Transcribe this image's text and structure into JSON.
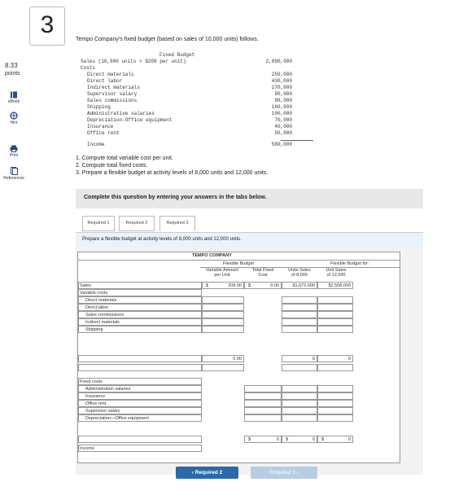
{
  "question": {
    "number": "3",
    "points_value": "8.33",
    "points_label": "points"
  },
  "side_tools": [
    {
      "label": "eBook",
      "icon": "book-icon"
    },
    {
      "label": "Hint",
      "icon": "hint-icon"
    },
    {
      "label": "Print",
      "icon": "print-icon"
    },
    {
      "label": "References",
      "icon": "references-icon"
    }
  ],
  "intro": "Tempo Company's fixed budget (based on sales of 10,000 units) follows.",
  "fixed_budget": {
    "title": "Fixed Budget",
    "sales_label": "Sales (10,000 units × $209 per unit)",
    "sales_value": "2,090,000",
    "costs_label": "Costs",
    "items": [
      {
        "label": "Direct materials",
        "value": "250,000"
      },
      {
        "label": "Direct labor",
        "value": "430,000"
      },
      {
        "label": "Indirect materials",
        "value": "270,000"
      },
      {
        "label": "Supervisor salary",
        "value": "90,000"
      },
      {
        "label": "Sales commissions",
        "value": "90,000"
      },
      {
        "label": "Shipping",
        "value": "160,000"
      },
      {
        "label": "Administrative salaries",
        "value": "100,000"
      },
      {
        "label": "Depreciation-Office equipment",
        "value": "70,000"
      },
      {
        "label": "Insurance",
        "value": "40,000"
      },
      {
        "label": "Office rent",
        "value": "50,000"
      }
    ],
    "total_value": "580,000",
    "income_label": "Income"
  },
  "tasks": [
    "1. Compute total variable cost per unit.",
    "2. Compute total fixed costs.",
    "3. Prepare a flexible budget at activity levels of 8,000 units and 12,000 units."
  ],
  "complete_note": "Complete this question by entering your answers in the tabs below.",
  "tabs": [
    "Required 1",
    "Required 2",
    "Required 3"
  ],
  "prepare_text": "Prepare a flexible budget at activity levels of 8,000 units and 12,000 units.",
  "table": {
    "company": "TEMPO COMPANY",
    "flexible_budget": "Flexible Budget",
    "flexible_budget_for": "Flexible Budget for:",
    "col_var": [
      "Variable Amount",
      "per Unit"
    ],
    "col_fixed": [
      "Total Fixed",
      "Cost"
    ],
    "col_8000": [
      "Units Sales",
      "of 8,000"
    ],
    "col_12000": [
      "Unit Sales",
      "of 12,000"
    ],
    "sales_label": "Sales",
    "dollar": "$",
    "sales_var": "209.00",
    "sales_fixed": "0.00",
    "sales_8000": "$1,672,000",
    "sales_12000": "$2,508,000",
    "variable_costs_label": "Variable costs",
    "variable_items": [
      "Direct materials",
      "Direct labor",
      "Sales commissions",
      "Indirect materials",
      "Shipping"
    ],
    "var_total": "0.00",
    "var_total_8000": "0",
    "var_total_12000": "0",
    "fixed_costs_label": "Fixed costs",
    "fixed_items": [
      "Administration salaries",
      "Insurance",
      "Office rent",
      "Supervisor salary",
      "Depreciation—Office equipment"
    ],
    "total_fixed": "0",
    "total_8000": "0",
    "total_12000": "0",
    "income_label": "Income"
  },
  "nav": {
    "prev": "Required 2",
    "next": "Required 3"
  }
}
